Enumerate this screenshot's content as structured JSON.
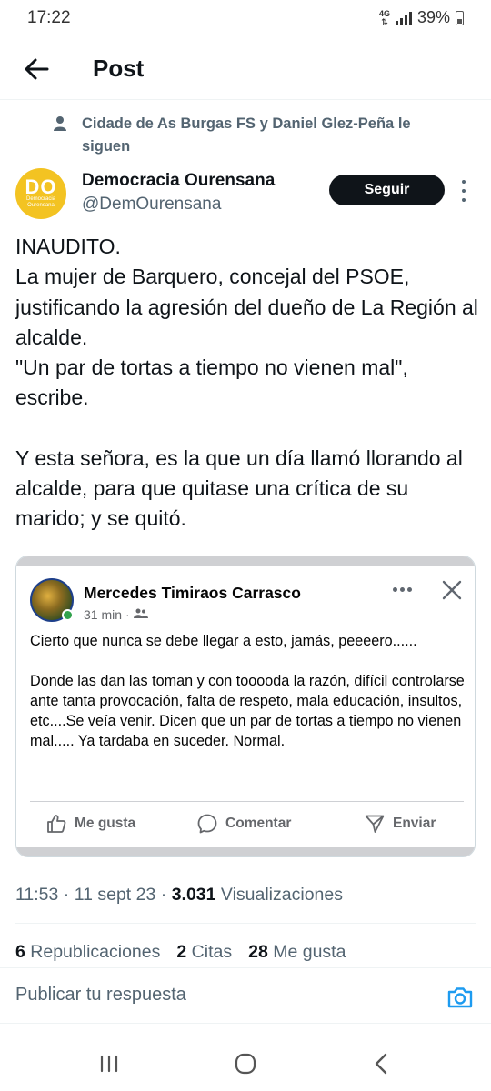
{
  "status_bar": {
    "time": "17:22",
    "network": "4G",
    "battery": "39%"
  },
  "header": {
    "title": "Post"
  },
  "social_context": {
    "text": "Cidade de As Burgas FS y Daniel Glez-Peña le siguen"
  },
  "author": {
    "name": "Democracia Ourensana",
    "handle": "@DemOurensana",
    "avatar_initials": "DO",
    "avatar_small_text": "Democracia Ourensana",
    "follow_label": "Seguir"
  },
  "tweet": {
    "paragraph1": "INAUDITO.\nLa mujer de Barquero, concejal del PSOE, justificando la agresión del dueño de La Región al alcalde.\n\"Un par de tortas a tiempo no vienen mal\", escribe.",
    "paragraph2": "Y esta señora, es la que un día llamó llorando al alcalde, para que quitase una crítica de su marido; y se quitó."
  },
  "embedded_post": {
    "name": "Mercedes Timiraos Carrasco",
    "time": "31 min",
    "separator": "·",
    "text1": "Cierto que nunca se debe llegar a esto, jamás, peeeero......",
    "text2": "Donde las dan las toman y con tooooda la razón, difícil controlarse ante tanta provocación, falta de respeto, mala educación, insultos, etc....Se veía venir. Dicen que un par de tortas a tiempo no vienen mal..... Ya tardaba en suceder. Normal.",
    "actions": {
      "like": "Me gusta",
      "comment": "Comentar",
      "send": "Enviar"
    }
  },
  "meta": {
    "time": "11:53",
    "date": "11 sept 23",
    "views_count": "3.031",
    "views_label": "Visualizaciones",
    "dot": "·"
  },
  "stats": {
    "reposts_count": "6",
    "reposts_label": "Republicaciones",
    "quotes_count": "2",
    "quotes_label": "Citas",
    "likes_count": "28",
    "likes_label": "Me gusta"
  },
  "reply": {
    "placeholder": "Publicar tu respuesta"
  },
  "colors": {
    "accent": "#1d9bf0",
    "avatar_yellow": "#f3c322",
    "text_secondary": "#536471"
  }
}
